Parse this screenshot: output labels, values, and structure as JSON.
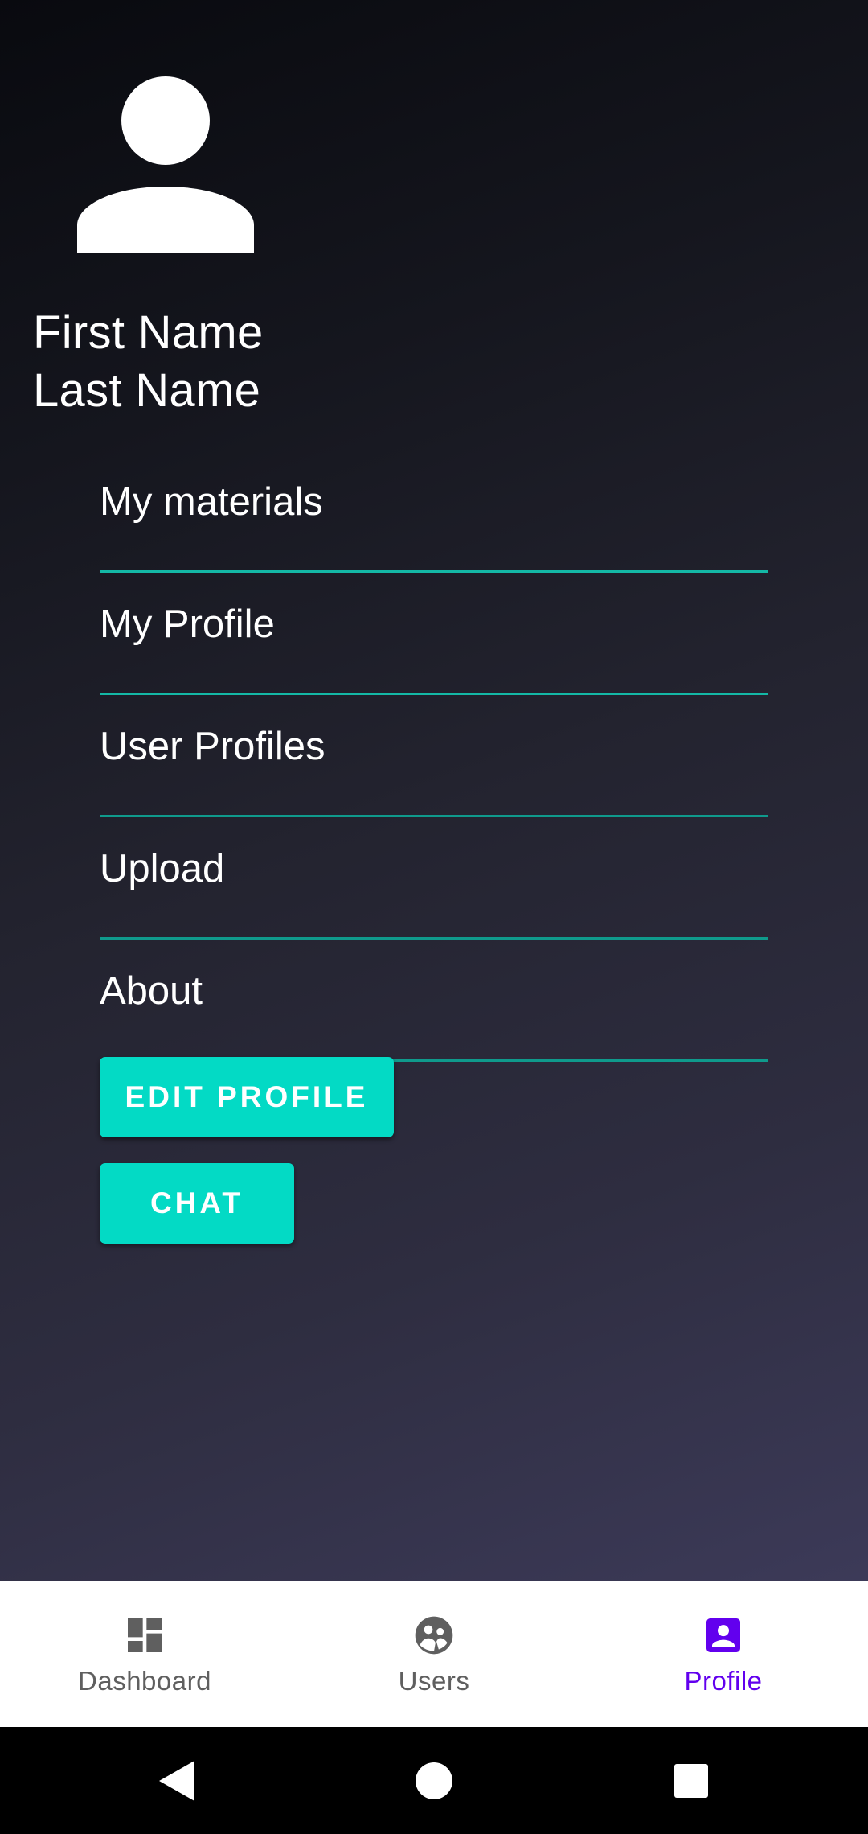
{
  "profile": {
    "first_name": "First Name",
    "last_name": "Last Name",
    "avatar_icon": "person-icon"
  },
  "menu": {
    "items": [
      {
        "label": "My materials"
      },
      {
        "label": "My Profile"
      },
      {
        "label": "User Profiles"
      },
      {
        "label": "Upload"
      },
      {
        "label": "About"
      }
    ]
  },
  "buttons": {
    "edit_profile": "EDIT PROFILE",
    "chat": "CHAT"
  },
  "bottom_nav": {
    "items": [
      {
        "label": "Dashboard",
        "icon": "dashboard-icon",
        "active": false
      },
      {
        "label": "Users",
        "icon": "users-icon",
        "active": false
      },
      {
        "label": "Profile",
        "icon": "profile-icon",
        "active": true
      }
    ]
  },
  "system_nav": {
    "icons": [
      "back-icon",
      "home-icon",
      "recents-icon"
    ]
  },
  "colors": {
    "accent": "#03dac5",
    "divider": "#14b8a6",
    "active_nav": "#6200ee",
    "inactive_nav": "#5f5f5f"
  }
}
